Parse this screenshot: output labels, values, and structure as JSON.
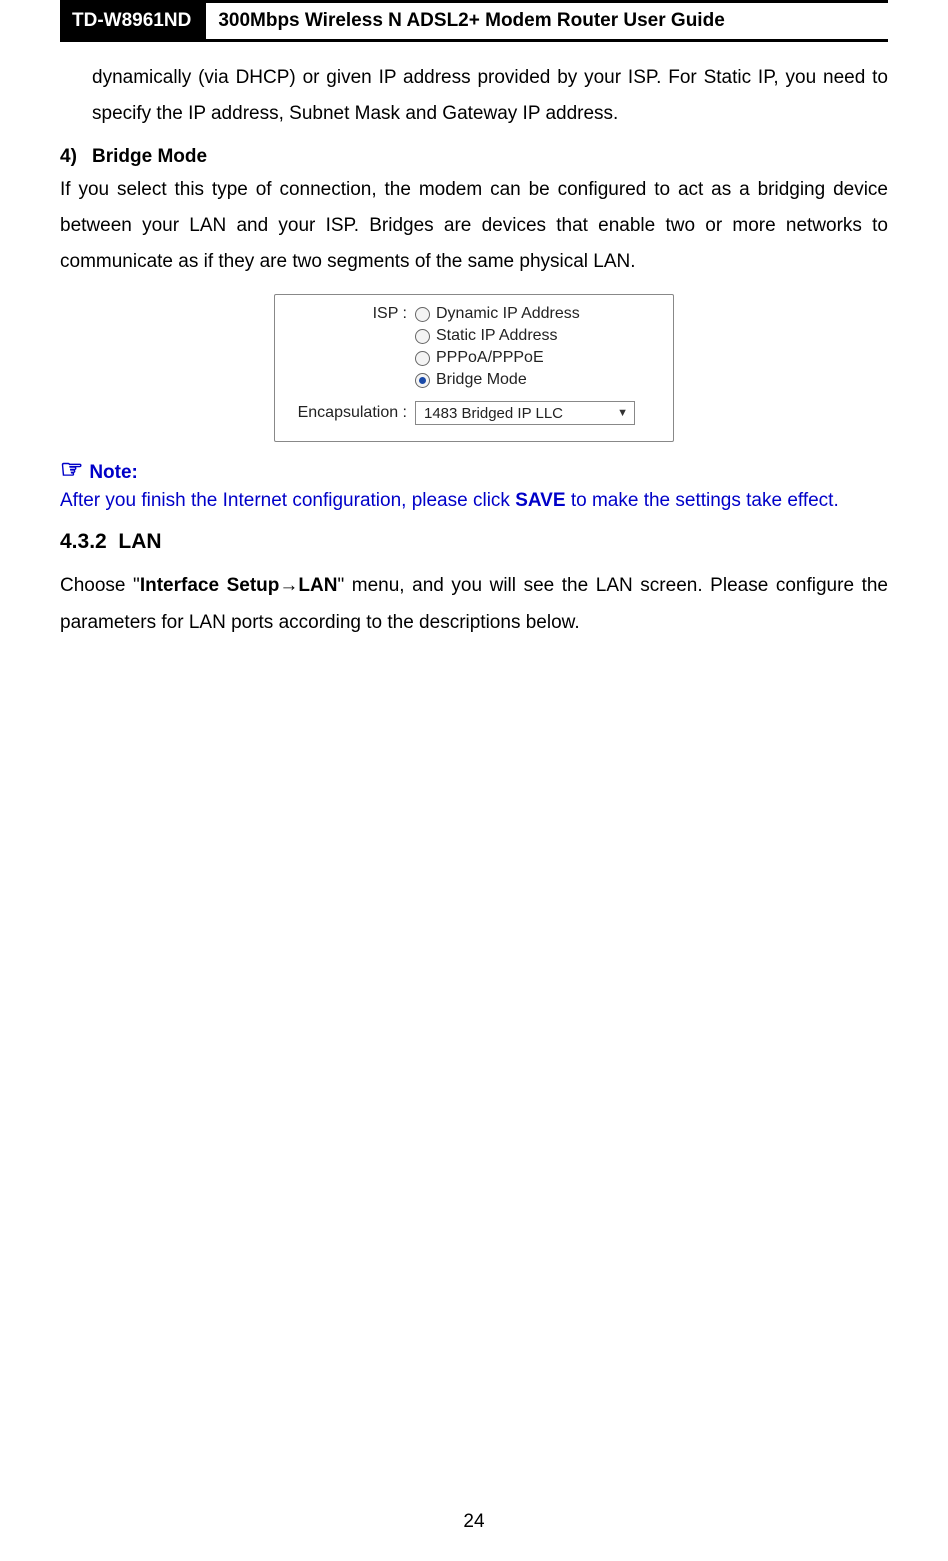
{
  "header": {
    "model": "TD-W8961ND",
    "title": "300Mbps Wireless N ADSL2+ Modem Router User Guide"
  },
  "intro_para": "dynamically (via DHCP) or given IP address provided by your ISP. For Static IP, you need to specify the IP address, Subnet Mask and Gateway IP address.",
  "item4": {
    "num": "4)",
    "title": "Bridge Mode",
    "body": "If you select this type of connection, the modem can be configured to act as a bridging device between your LAN and your ISP. Bridges are devices that enable two or more networks to communicate as if they are two segments of the same physical LAN."
  },
  "figure": {
    "isp_label": "ISP :",
    "options": {
      "dyn": "Dynamic IP Address",
      "stat": "Static IP Address",
      "pppoa": "PPPoA/PPPoE",
      "bridge": "Bridge Mode"
    },
    "encap_label": "Encapsulation :",
    "encap_value": "1483 Bridged IP LLC"
  },
  "note": {
    "icon": "☞",
    "label": "Note:",
    "body_before": "After you finish the Internet configuration, please click ",
    "body_bold": "SAVE",
    "body_after": " to make the settings take effect."
  },
  "section": {
    "num": "4.3.2",
    "title": "LAN",
    "para_before": "Choose \"",
    "para_b1": "Interface Setup",
    "para_arrow": "→",
    "para_b2": "LAN",
    "para_after": "\" menu, and you will see the LAN screen. Please configure the parameters for LAN ports according to the descriptions below."
  },
  "page_number": "24"
}
